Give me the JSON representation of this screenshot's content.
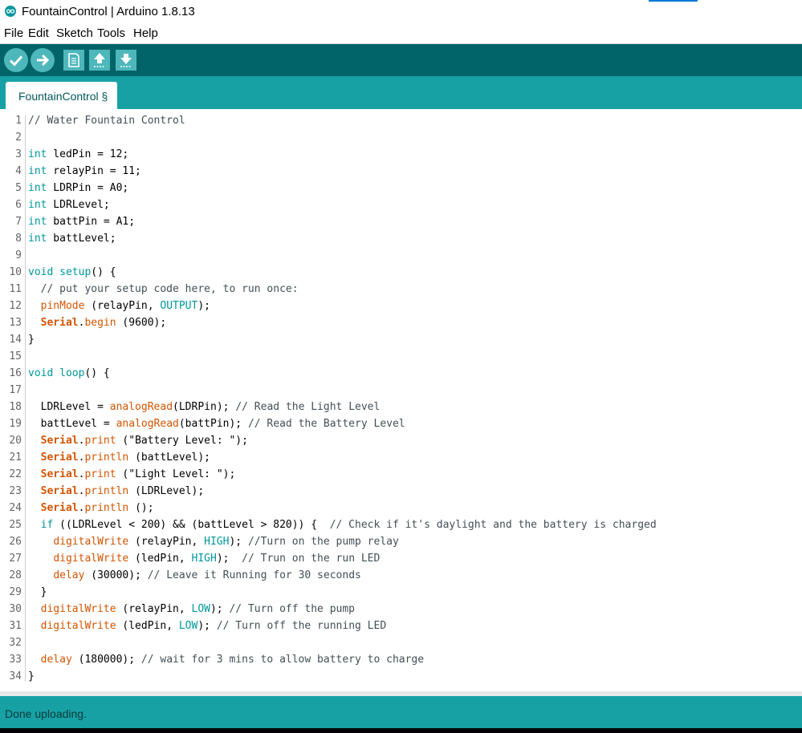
{
  "window": {
    "title": "FountainControl | Arduino 1.8.13"
  },
  "menu": [
    "File",
    "Edit",
    "Sketch",
    "Tools",
    "Help"
  ],
  "toolbar": {
    "buttons": [
      "verify-icon",
      "upload-icon",
      "new-icon",
      "open-icon",
      "save-icon"
    ]
  },
  "tab": {
    "label": "FountainControl §"
  },
  "colors": {
    "keyword": "#00979c",
    "function": "#d35400",
    "comment": "#434f54",
    "toolbar": "#006468",
    "accent": "#17a1a5"
  },
  "code_lines": [
    {
      "n": "1",
      "tokens": [
        {
          "t": "// Water Fountain Control",
          "c": "cm"
        }
      ]
    },
    {
      "n": "2",
      "tokens": []
    },
    {
      "n": "3",
      "tokens": [
        {
          "t": "int",
          "c": "kw"
        },
        {
          "t": " ledPin = 12;",
          "c": ""
        }
      ]
    },
    {
      "n": "4",
      "tokens": [
        {
          "t": "int",
          "c": "kw"
        },
        {
          "t": " relayPin = 11;",
          "c": ""
        }
      ]
    },
    {
      "n": "5",
      "tokens": [
        {
          "t": "int",
          "c": "kw"
        },
        {
          "t": " LDRPin = A0;",
          "c": ""
        }
      ]
    },
    {
      "n": "6",
      "tokens": [
        {
          "t": "int",
          "c": "kw"
        },
        {
          "t": " LDRLevel;",
          "c": ""
        }
      ]
    },
    {
      "n": "7",
      "tokens": [
        {
          "t": "int",
          "c": "kw"
        },
        {
          "t": " battPin = A1;",
          "c": ""
        }
      ]
    },
    {
      "n": "8",
      "tokens": [
        {
          "t": "int",
          "c": "kw"
        },
        {
          "t": " battLevel;",
          "c": ""
        }
      ]
    },
    {
      "n": "9",
      "tokens": []
    },
    {
      "n": "10",
      "tokens": [
        {
          "t": "void",
          "c": "kw"
        },
        {
          "t": " ",
          "c": ""
        },
        {
          "t": "setup",
          "c": "fn2"
        },
        {
          "t": "() {",
          "c": ""
        }
      ]
    },
    {
      "n": "11",
      "tokens": [
        {
          "t": "  // put your setup code here, to run once:",
          "c": "cm"
        }
      ]
    },
    {
      "n": "12",
      "tokens": [
        {
          "t": "  ",
          "c": ""
        },
        {
          "t": "pinMode",
          "c": "fn"
        },
        {
          "t": " (relayPin, ",
          "c": ""
        },
        {
          "t": "OUTPUT",
          "c": "kw"
        },
        {
          "t": ");",
          "c": ""
        }
      ]
    },
    {
      "n": "13",
      "tokens": [
        {
          "t": "  ",
          "c": ""
        },
        {
          "t": "Serial",
          "c": "fnb"
        },
        {
          "t": ".",
          "c": ""
        },
        {
          "t": "begin",
          "c": "fn"
        },
        {
          "t": " (9600);",
          "c": ""
        }
      ]
    },
    {
      "n": "14",
      "tokens": [
        {
          "t": "}",
          "c": ""
        }
      ]
    },
    {
      "n": "15",
      "tokens": []
    },
    {
      "n": "16",
      "tokens": [
        {
          "t": "void",
          "c": "kw"
        },
        {
          "t": " ",
          "c": ""
        },
        {
          "t": "loop",
          "c": "fn2"
        },
        {
          "t": "() {",
          "c": ""
        }
      ]
    },
    {
      "n": "17",
      "tokens": []
    },
    {
      "n": "18",
      "tokens": [
        {
          "t": "  LDRLevel = ",
          "c": ""
        },
        {
          "t": "analogRead",
          "c": "fn"
        },
        {
          "t": "(LDRPin); ",
          "c": ""
        },
        {
          "t": "// Read the Light Level",
          "c": "cm"
        }
      ]
    },
    {
      "n": "19",
      "tokens": [
        {
          "t": "  battLevel = ",
          "c": ""
        },
        {
          "t": "analogRead",
          "c": "fn"
        },
        {
          "t": "(battPin); ",
          "c": ""
        },
        {
          "t": "// Read the Battery Level",
          "c": "cm"
        }
      ]
    },
    {
      "n": "20",
      "tokens": [
        {
          "t": "  ",
          "c": ""
        },
        {
          "t": "Serial",
          "c": "fnb"
        },
        {
          "t": ".",
          "c": ""
        },
        {
          "t": "print",
          "c": "fn"
        },
        {
          "t": " (\"Battery Level: \");",
          "c": ""
        }
      ]
    },
    {
      "n": "21",
      "tokens": [
        {
          "t": "  ",
          "c": ""
        },
        {
          "t": "Serial",
          "c": "fnb"
        },
        {
          "t": ".",
          "c": ""
        },
        {
          "t": "println",
          "c": "fn"
        },
        {
          "t": " (battLevel);",
          "c": ""
        }
      ]
    },
    {
      "n": "22",
      "tokens": [
        {
          "t": "  ",
          "c": ""
        },
        {
          "t": "Serial",
          "c": "fnb"
        },
        {
          "t": ".",
          "c": ""
        },
        {
          "t": "print",
          "c": "fn"
        },
        {
          "t": " (\"Light Level: \");",
          "c": ""
        }
      ]
    },
    {
      "n": "23",
      "tokens": [
        {
          "t": "  ",
          "c": ""
        },
        {
          "t": "Serial",
          "c": "fnb"
        },
        {
          "t": ".",
          "c": ""
        },
        {
          "t": "println",
          "c": "fn"
        },
        {
          "t": " (LDRLevel);",
          "c": ""
        }
      ]
    },
    {
      "n": "24",
      "tokens": [
        {
          "t": "  ",
          "c": ""
        },
        {
          "t": "Serial",
          "c": "fnb"
        },
        {
          "t": ".",
          "c": ""
        },
        {
          "t": "println",
          "c": "fn"
        },
        {
          "t": " ();",
          "c": ""
        }
      ]
    },
    {
      "n": "25",
      "tokens": [
        {
          "t": "  ",
          "c": ""
        },
        {
          "t": "if",
          "c": "fn2"
        },
        {
          "t": " ((LDRLevel < 200) && (battLevel > 820)) {  ",
          "c": ""
        },
        {
          "t": "// Check if it's daylight and the battery is charged",
          "c": "cm"
        }
      ]
    },
    {
      "n": "26",
      "tokens": [
        {
          "t": "    ",
          "c": ""
        },
        {
          "t": "digitalWrite",
          "c": "fn"
        },
        {
          "t": " (relayPin, ",
          "c": ""
        },
        {
          "t": "HIGH",
          "c": "kw"
        },
        {
          "t": "); ",
          "c": ""
        },
        {
          "t": "//Turn on the pump relay",
          "c": "cm"
        }
      ]
    },
    {
      "n": "27",
      "tokens": [
        {
          "t": "    ",
          "c": ""
        },
        {
          "t": "digitalWrite",
          "c": "fn"
        },
        {
          "t": " (ledPin, ",
          "c": ""
        },
        {
          "t": "HIGH",
          "c": "kw"
        },
        {
          "t": ");  ",
          "c": ""
        },
        {
          "t": "// Trun on the run LED",
          "c": "cm"
        }
      ]
    },
    {
      "n": "28",
      "tokens": [
        {
          "t": "    ",
          "c": ""
        },
        {
          "t": "delay",
          "c": "fn"
        },
        {
          "t": " (30000); ",
          "c": ""
        },
        {
          "t": "// Leave it Running for 30 seconds",
          "c": "cm"
        }
      ]
    },
    {
      "n": "29",
      "tokens": [
        {
          "t": "  }",
          "c": ""
        }
      ]
    },
    {
      "n": "30",
      "tokens": [
        {
          "t": "  ",
          "c": ""
        },
        {
          "t": "digitalWrite",
          "c": "fn"
        },
        {
          "t": " (relayPin, ",
          "c": ""
        },
        {
          "t": "LOW",
          "c": "kw"
        },
        {
          "t": "); ",
          "c": ""
        },
        {
          "t": "// Turn off the pump",
          "c": "cm"
        }
      ]
    },
    {
      "n": "31",
      "tokens": [
        {
          "t": "  ",
          "c": ""
        },
        {
          "t": "digitalWrite",
          "c": "fn"
        },
        {
          "t": " (ledPin, ",
          "c": ""
        },
        {
          "t": "LOW",
          "c": "kw"
        },
        {
          "t": "); ",
          "c": ""
        },
        {
          "t": "// Turn off the running LED",
          "c": "cm"
        }
      ]
    },
    {
      "n": "32",
      "tokens": []
    },
    {
      "n": "33",
      "tokens": [
        {
          "t": "  ",
          "c": ""
        },
        {
          "t": "delay",
          "c": "fn"
        },
        {
          "t": " (180000); ",
          "c": ""
        },
        {
          "t": "// wait for 3 mins to allow battery to charge",
          "c": "cm"
        }
      ]
    },
    {
      "n": "34",
      "tokens": [
        {
          "t": "}",
          "c": ""
        }
      ]
    }
  ],
  "status": {
    "message": "Done uploading."
  }
}
